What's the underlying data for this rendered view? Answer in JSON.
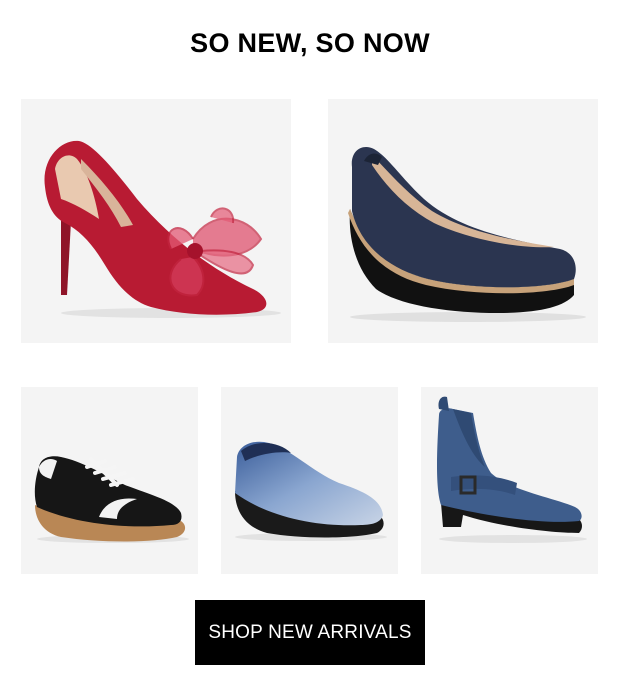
{
  "headline": "SO NEW, SO NOW",
  "products": [
    {
      "name": "red-satin-bow-pump-icon"
    },
    {
      "name": "navy-wedge-pump-icon"
    },
    {
      "name": "black-gum-sole-sneaker-icon"
    },
    {
      "name": "blue-patent-clog-icon"
    },
    {
      "name": "blue-suede-buckle-bootie-icon"
    }
  ],
  "cta": {
    "label": "SHOP NEW ARRIVALS"
  },
  "colors": {
    "background": "#ffffff",
    "tile": "#f4f4f4",
    "button": "#000000",
    "button_text": "#ffffff"
  }
}
